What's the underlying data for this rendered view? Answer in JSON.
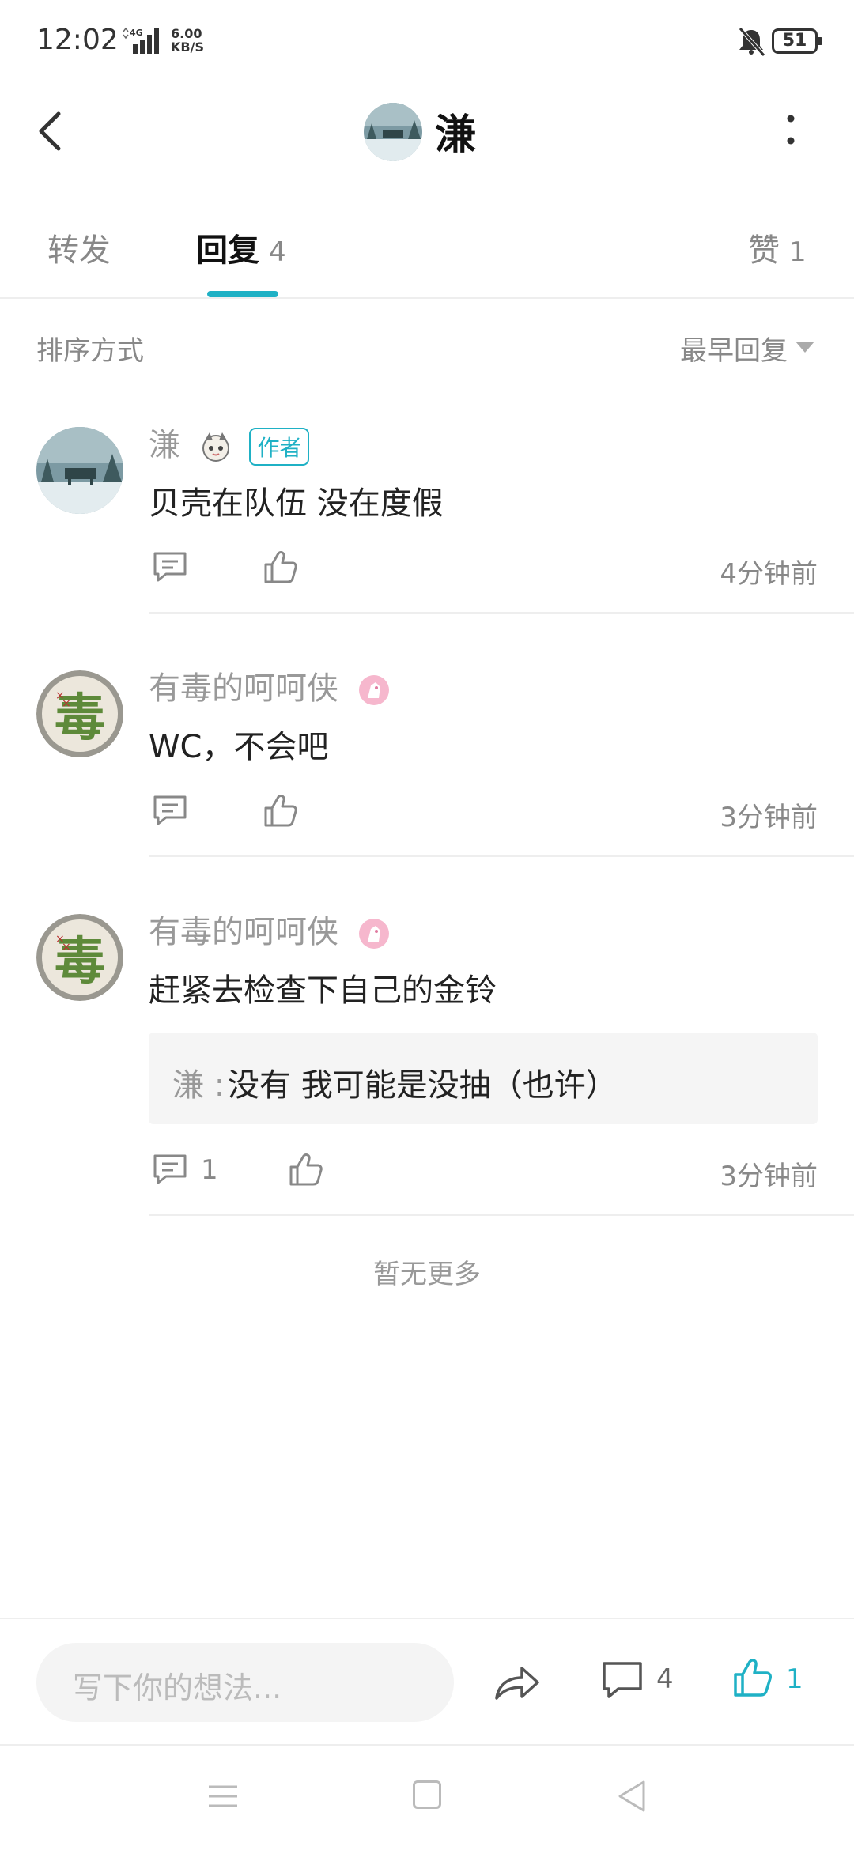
{
  "status_bar": {
    "time": "12:02",
    "network": "4G",
    "speed_value": "6.00",
    "speed_unit": "KB/S",
    "battery": "51"
  },
  "header": {
    "title": "溓",
    "avatar_icon": "winter-scene-avatar"
  },
  "tabs": [
    {
      "label": "转发",
      "count": ""
    },
    {
      "label": "回复",
      "count": "4"
    },
    {
      "label": "赞",
      "count": "1"
    }
  ],
  "sort": {
    "label": "排序方式",
    "value": "最早回复"
  },
  "comments": [
    {
      "name": "溓",
      "badge": "作者",
      "text": "贝壳在队伍 没在度假",
      "reply_count": "",
      "time": "4分钟前"
    },
    {
      "name": "有毒的呵呵侠",
      "text": "WC，不会吧",
      "reply_count": "",
      "time": "3分钟前"
    },
    {
      "name": "有毒的呵呵侠",
      "text": "赶紧去检查下自己的金铃",
      "quote": {
        "name": "溓 :",
        "text": "没有 我可能是没抽（也许）"
      },
      "reply_count": "1",
      "time": "3分钟前"
    }
  ],
  "footer_note": "暂无更多",
  "bottom_bar": {
    "placeholder": "写下你的想法...",
    "comment_count": "4",
    "like_count": "1"
  },
  "colors": {
    "accent": "#1fb1c5",
    "text_primary": "#222222",
    "text_secondary": "#888888"
  }
}
